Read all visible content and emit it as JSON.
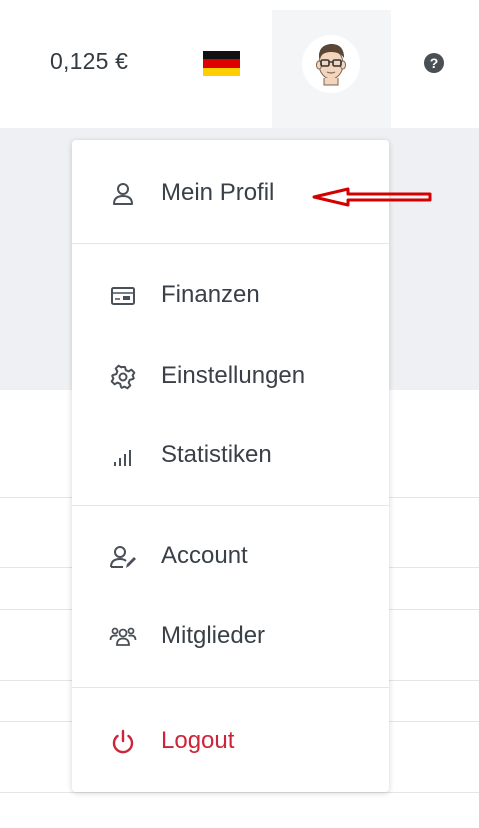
{
  "header": {
    "balance": "0,125 €",
    "language_flag": "germany-flag-icon",
    "avatar_icon": "user-avatar-icon",
    "help_icon": "question-circle-icon"
  },
  "menu": {
    "items": [
      {
        "label": "Mein Profil",
        "icon": "user-icon"
      },
      {
        "label": "Finanzen",
        "icon": "wallet-card-icon"
      },
      {
        "label": "Einstellungen",
        "icon": "gear-icon"
      },
      {
        "label": "Statistiken",
        "icon": "bar-chart-icon"
      },
      {
        "label": "Account",
        "icon": "user-edit-icon"
      },
      {
        "label": "Mitglieder",
        "icon": "users-group-icon"
      },
      {
        "label": "Logout",
        "icon": "power-icon"
      }
    ]
  },
  "colors": {
    "text": "#3a4047",
    "logout": "#cc2438",
    "annotation_arrow": "#d40000",
    "band": "#eef0f3"
  }
}
